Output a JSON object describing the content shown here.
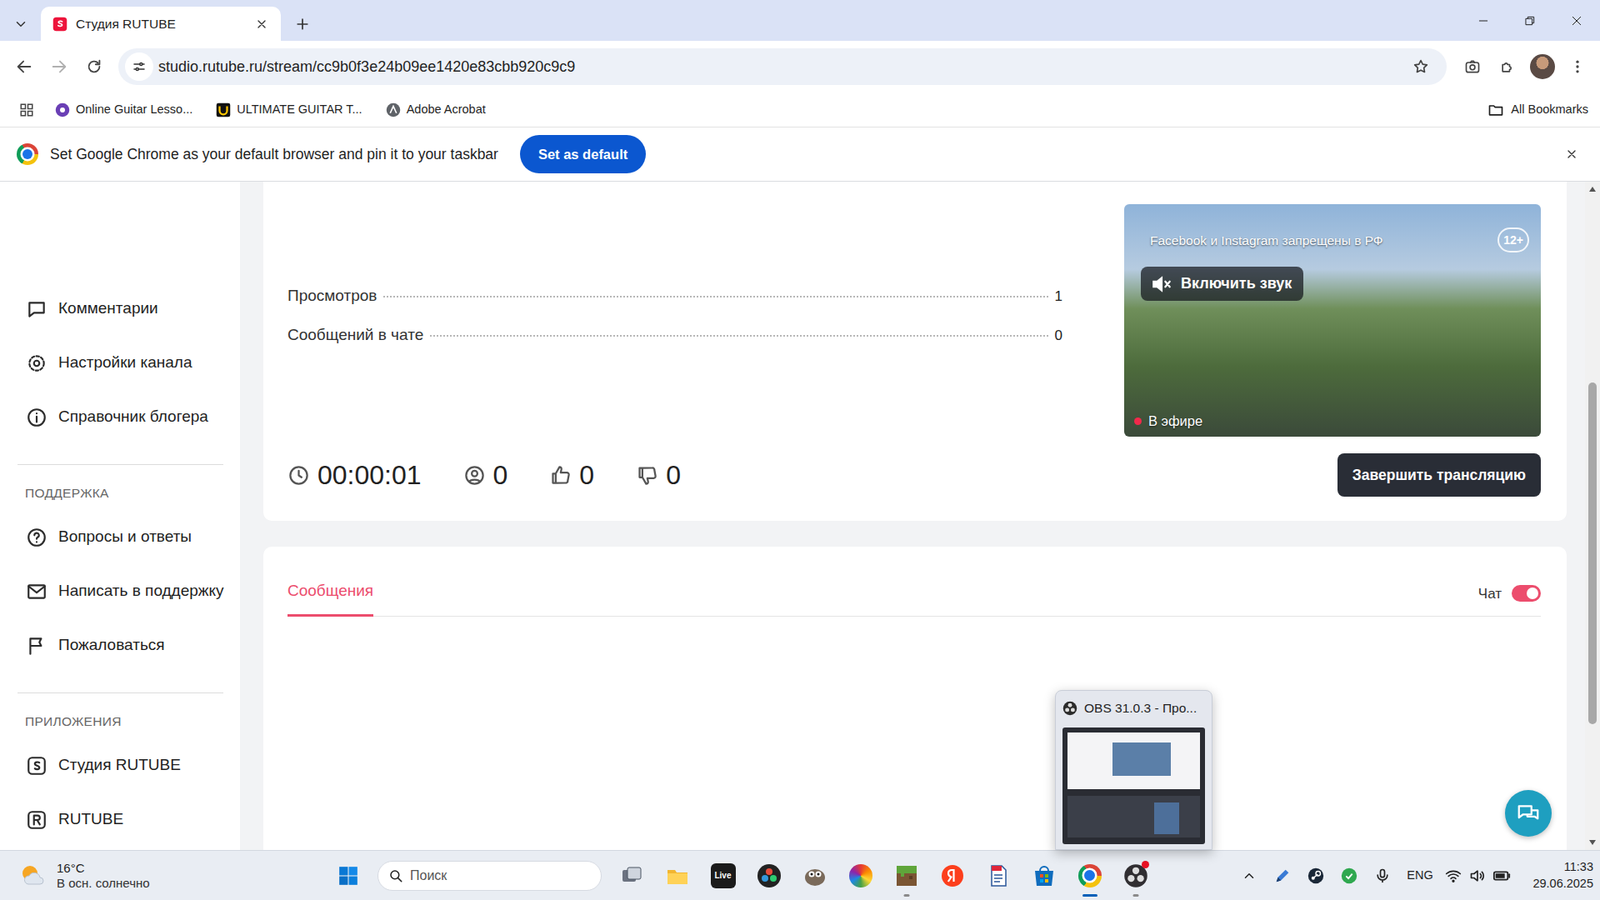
{
  "browser": {
    "tabs": [
      {
        "title": "Студия RUTUBE",
        "selected": true
      }
    ],
    "address": {
      "url": "studio.rutube.ru/stream/cc9b0f3e24b09ee1420e83cbb920c9c9",
      "bookmarked": false
    },
    "bookmarks": [
      {
        "label": "Online Guitar Lesso..."
      },
      {
        "label": "ULTIMATE GUITAR T..."
      },
      {
        "label": "Adobe Acrobat"
      }
    ],
    "all_bookmarks": "All Bookmarks",
    "infobar": {
      "text": "Set Google Chrome as your default browser and pin it to your taskbar",
      "button": "Set as default"
    }
  },
  "sidebar": {
    "items": [
      {
        "label": "Комментарии"
      },
      {
        "label": "Настройки канала"
      },
      {
        "label": "Справочник блогера"
      }
    ],
    "sections": [
      {
        "heading": "ПОДДЕРЖКА",
        "items": [
          {
            "label": "Вопросы и ответы"
          },
          {
            "label": "Написать в поддержку"
          },
          {
            "label": "Пожаловаться"
          }
        ]
      },
      {
        "heading": "ПРИЛОЖЕНИЯ",
        "items": [
          {
            "label": "Студия RUTUBE"
          },
          {
            "label": "RUTUBE"
          }
        ]
      }
    ]
  },
  "stream": {
    "stats": [
      {
        "label": "Просмотров",
        "value": "1"
      },
      {
        "label": "Сообщений в чате",
        "value": "0"
      }
    ],
    "duration": "00:00:01",
    "viewers": "0",
    "likes": "0",
    "dislikes": "0",
    "player": {
      "notice": "Facebook и Instagram запрещены в РФ",
      "age": "12+",
      "unmute": "Включить звук",
      "muted": true,
      "live": "В эфире"
    },
    "end_button": "Завершить трансляцию"
  },
  "chat": {
    "tabs": [
      {
        "label": "Сообщения",
        "selected": true
      }
    ],
    "toggle": {
      "label": "Чат",
      "on": true
    }
  },
  "taskbar_preview": {
    "title": "OBS 31.0.3 - Про..."
  },
  "taskbar": {
    "weather": {
      "temp": "16°C",
      "desc": "В осн. солнечно"
    },
    "search": {
      "placeholder": "Поиск"
    },
    "apps": [
      {
        "text": "",
        "running": false,
        "active": false,
        "recording": false
      },
      {
        "text": "",
        "running": false,
        "active": false,
        "recording": false
      },
      {
        "text": "Live",
        "running": false,
        "active": false,
        "recording": false
      },
      {
        "text": "",
        "running": false,
        "active": false,
        "recording": false
      },
      {
        "text": "",
        "running": false,
        "active": false,
        "recording": false
      },
      {
        "text": "",
        "running": false,
        "active": false,
        "recording": false
      },
      {
        "text": "",
        "running": true,
        "active": false,
        "recording": false
      },
      {
        "text": "",
        "running": false,
        "active": false,
        "recording": false
      },
      {
        "text": "",
        "running": false,
        "active": false,
        "recording": false
      },
      {
        "text": "",
        "running": false,
        "active": false,
        "recording": false
      },
      {
        "text": "",
        "running": true,
        "active": true,
        "recording": false
      },
      {
        "text": "",
        "running": true,
        "active": false,
        "recording": true
      }
    ],
    "tray": {
      "lang": "ENG",
      "time": "11:33",
      "date": "29.06.2025"
    }
  }
}
